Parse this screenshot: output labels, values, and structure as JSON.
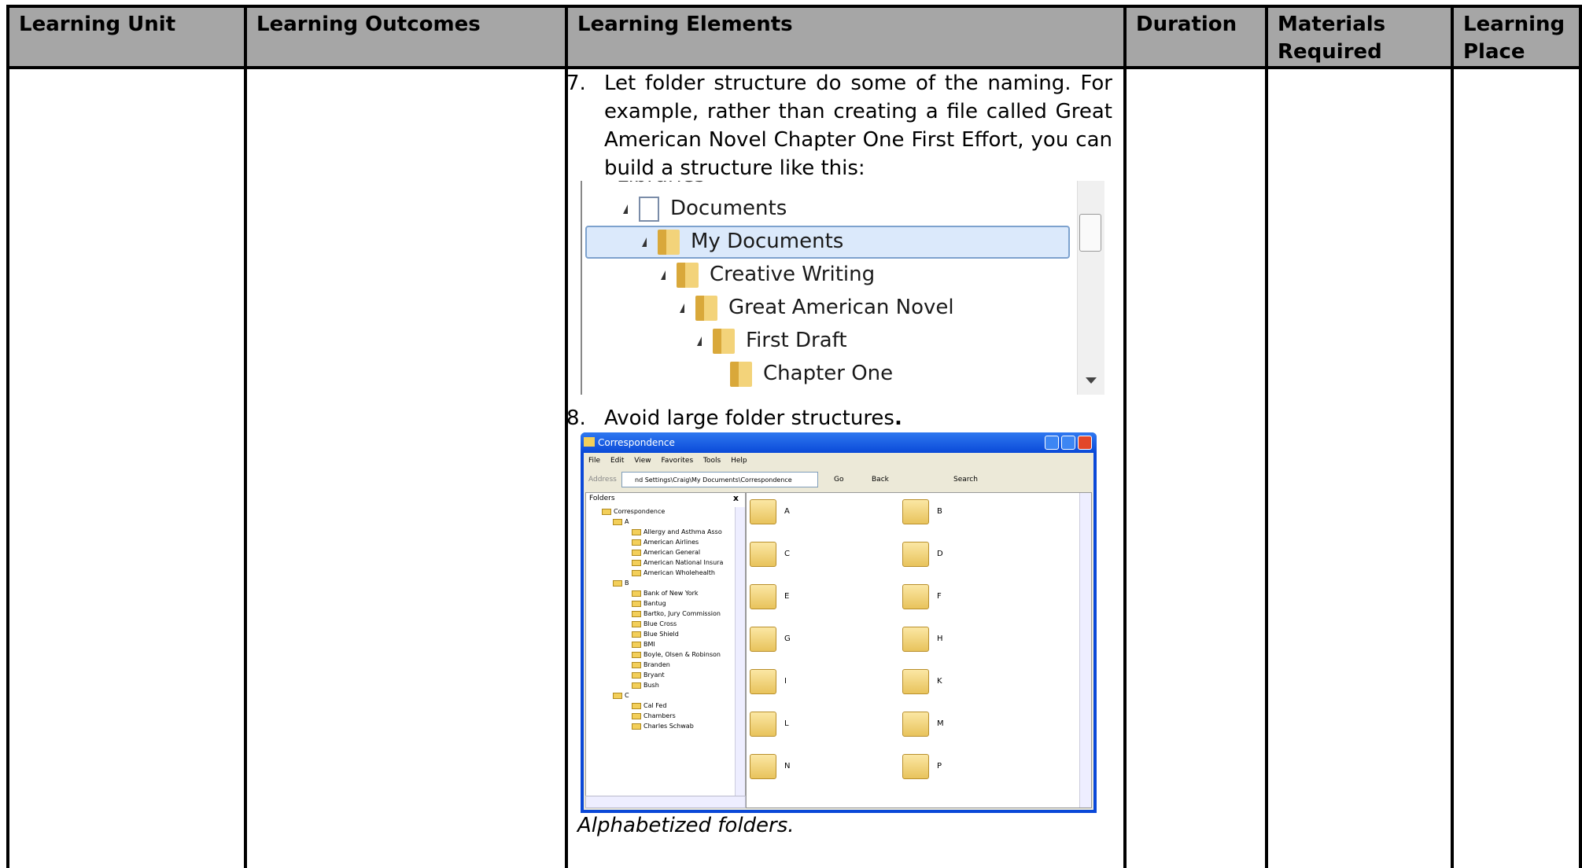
{
  "headers": {
    "learning_unit": "Learning Unit",
    "learning_outcomes": "Learning Outcomes",
    "learning_elements": "Learning Elements",
    "duration": "Duration",
    "materials_required_1": "Materials",
    "materials_required_2": "Required",
    "learning_place_1": "Learning",
    "learning_place_2": "Place"
  },
  "items": [
    {
      "number": "7.",
      "lines": [
        "Let folder structure do some of the naming. For",
        "example, rather than creating a file called Great",
        "American Novel Chapter One First Effort, you can",
        "build a structure like this:"
      ]
    },
    {
      "number": "8.",
      "text": "Avoid large folder structures",
      "punct": "."
    }
  ],
  "tree": {
    "partial_top": "Libraries",
    "rows": [
      "Documents",
      "My Documents",
      "Creative Writing",
      "Great American Novel",
      "First Draft",
      "Chapter One"
    ]
  },
  "explorer": {
    "title": "Correspondence",
    "menu": [
      "File",
      "Edit",
      "View",
      "Favorites",
      "Tools",
      "Help"
    ],
    "address_label": "Address",
    "address_value": "nd Settings\\Craig\\My Documents\\Correspondence",
    "go": "Go",
    "back": "Back",
    "search": "Search",
    "folders_label": "Folders",
    "folder_tree": [
      "Correspondence",
      "A",
      "Allergy and Asthma Asso",
      "American Airlines",
      "American General",
      "American National Insura",
      "American Wholehealth",
      "B",
      "Bank of New York",
      "Bantug",
      "Bartko, Jury Commission",
      "Blue Cross",
      "Blue Shield",
      "BMI",
      "Boyle, Olsen & Robinson",
      "Branden",
      "Bryant",
      "Bush",
      "C",
      "Cal Fed",
      "Chambers",
      "Charles Schwab"
    ],
    "content_folders": [
      "A",
      "B",
      "C",
      "D",
      "E",
      "F",
      "G",
      "H",
      "I",
      "K",
      "L",
      "M",
      "N",
      "P"
    ]
  },
  "caption": "Alphabetized folders."
}
